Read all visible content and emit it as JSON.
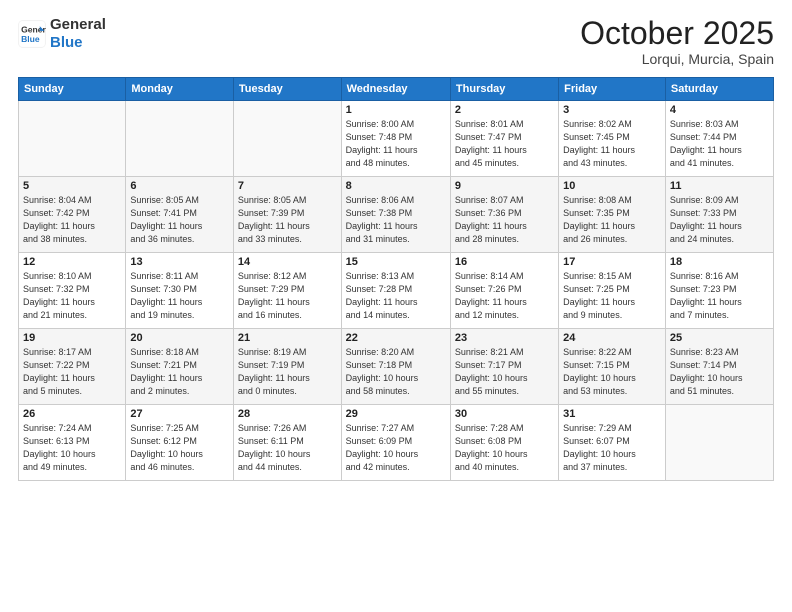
{
  "header": {
    "logo_line1": "General",
    "logo_line2": "Blue",
    "month": "October 2025",
    "location": "Lorqui, Murcia, Spain"
  },
  "weekdays": [
    "Sunday",
    "Monday",
    "Tuesday",
    "Wednesday",
    "Thursday",
    "Friday",
    "Saturday"
  ],
  "weeks": [
    [
      {
        "num": "",
        "info": ""
      },
      {
        "num": "",
        "info": ""
      },
      {
        "num": "",
        "info": ""
      },
      {
        "num": "1",
        "info": "Sunrise: 8:00 AM\nSunset: 7:48 PM\nDaylight: 11 hours\nand 48 minutes."
      },
      {
        "num": "2",
        "info": "Sunrise: 8:01 AM\nSunset: 7:47 PM\nDaylight: 11 hours\nand 45 minutes."
      },
      {
        "num": "3",
        "info": "Sunrise: 8:02 AM\nSunset: 7:45 PM\nDaylight: 11 hours\nand 43 minutes."
      },
      {
        "num": "4",
        "info": "Sunrise: 8:03 AM\nSunset: 7:44 PM\nDaylight: 11 hours\nand 41 minutes."
      }
    ],
    [
      {
        "num": "5",
        "info": "Sunrise: 8:04 AM\nSunset: 7:42 PM\nDaylight: 11 hours\nand 38 minutes."
      },
      {
        "num": "6",
        "info": "Sunrise: 8:05 AM\nSunset: 7:41 PM\nDaylight: 11 hours\nand 36 minutes."
      },
      {
        "num": "7",
        "info": "Sunrise: 8:05 AM\nSunset: 7:39 PM\nDaylight: 11 hours\nand 33 minutes."
      },
      {
        "num": "8",
        "info": "Sunrise: 8:06 AM\nSunset: 7:38 PM\nDaylight: 11 hours\nand 31 minutes."
      },
      {
        "num": "9",
        "info": "Sunrise: 8:07 AM\nSunset: 7:36 PM\nDaylight: 11 hours\nand 28 minutes."
      },
      {
        "num": "10",
        "info": "Sunrise: 8:08 AM\nSunset: 7:35 PM\nDaylight: 11 hours\nand 26 minutes."
      },
      {
        "num": "11",
        "info": "Sunrise: 8:09 AM\nSunset: 7:33 PM\nDaylight: 11 hours\nand 24 minutes."
      }
    ],
    [
      {
        "num": "12",
        "info": "Sunrise: 8:10 AM\nSunset: 7:32 PM\nDaylight: 11 hours\nand 21 minutes."
      },
      {
        "num": "13",
        "info": "Sunrise: 8:11 AM\nSunset: 7:30 PM\nDaylight: 11 hours\nand 19 minutes."
      },
      {
        "num": "14",
        "info": "Sunrise: 8:12 AM\nSunset: 7:29 PM\nDaylight: 11 hours\nand 16 minutes."
      },
      {
        "num": "15",
        "info": "Sunrise: 8:13 AM\nSunset: 7:28 PM\nDaylight: 11 hours\nand 14 minutes."
      },
      {
        "num": "16",
        "info": "Sunrise: 8:14 AM\nSunset: 7:26 PM\nDaylight: 11 hours\nand 12 minutes."
      },
      {
        "num": "17",
        "info": "Sunrise: 8:15 AM\nSunset: 7:25 PM\nDaylight: 11 hours\nand 9 minutes."
      },
      {
        "num": "18",
        "info": "Sunrise: 8:16 AM\nSunset: 7:23 PM\nDaylight: 11 hours\nand 7 minutes."
      }
    ],
    [
      {
        "num": "19",
        "info": "Sunrise: 8:17 AM\nSunset: 7:22 PM\nDaylight: 11 hours\nand 5 minutes."
      },
      {
        "num": "20",
        "info": "Sunrise: 8:18 AM\nSunset: 7:21 PM\nDaylight: 11 hours\nand 2 minutes."
      },
      {
        "num": "21",
        "info": "Sunrise: 8:19 AM\nSunset: 7:19 PM\nDaylight: 11 hours\nand 0 minutes."
      },
      {
        "num": "22",
        "info": "Sunrise: 8:20 AM\nSunset: 7:18 PM\nDaylight: 10 hours\nand 58 minutes."
      },
      {
        "num": "23",
        "info": "Sunrise: 8:21 AM\nSunset: 7:17 PM\nDaylight: 10 hours\nand 55 minutes."
      },
      {
        "num": "24",
        "info": "Sunrise: 8:22 AM\nSunset: 7:15 PM\nDaylight: 10 hours\nand 53 minutes."
      },
      {
        "num": "25",
        "info": "Sunrise: 8:23 AM\nSunset: 7:14 PM\nDaylight: 10 hours\nand 51 minutes."
      }
    ],
    [
      {
        "num": "26",
        "info": "Sunrise: 7:24 AM\nSunset: 6:13 PM\nDaylight: 10 hours\nand 49 minutes."
      },
      {
        "num": "27",
        "info": "Sunrise: 7:25 AM\nSunset: 6:12 PM\nDaylight: 10 hours\nand 46 minutes."
      },
      {
        "num": "28",
        "info": "Sunrise: 7:26 AM\nSunset: 6:11 PM\nDaylight: 10 hours\nand 44 minutes."
      },
      {
        "num": "29",
        "info": "Sunrise: 7:27 AM\nSunset: 6:09 PM\nDaylight: 10 hours\nand 42 minutes."
      },
      {
        "num": "30",
        "info": "Sunrise: 7:28 AM\nSunset: 6:08 PM\nDaylight: 10 hours\nand 40 minutes."
      },
      {
        "num": "31",
        "info": "Sunrise: 7:29 AM\nSunset: 6:07 PM\nDaylight: 10 hours\nand 37 minutes."
      },
      {
        "num": "",
        "info": ""
      }
    ]
  ]
}
